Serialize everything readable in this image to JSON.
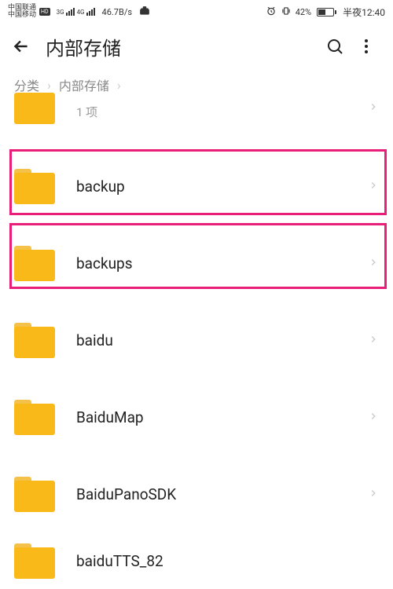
{
  "status": {
    "carrier1": "中国联通",
    "carrier2": "中国移动",
    "net1": "3G",
    "net2": "4G",
    "speed": "46.7B/s",
    "battPct": "42%",
    "timeLabel": "半夜12:40"
  },
  "header": {
    "title": "内部存储"
  },
  "breadcrumb": {
    "a": "分类",
    "b": "内部存储"
  },
  "rows": {
    "partialTopSub": "1 项",
    "r1": "backup",
    "r2": "backups",
    "r3": "baidu",
    "r4": "BaiduMap",
    "r5": "BaiduPanoSDK",
    "r6": "baiduTTS_82"
  }
}
